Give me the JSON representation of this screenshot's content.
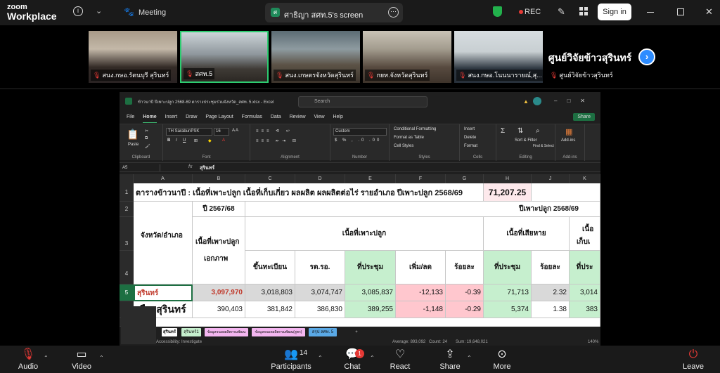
{
  "app": {
    "logo_line1": "zoom",
    "logo_line2": "Workplace"
  },
  "topbar": {
    "meeting_label": "Meeting",
    "share_badge": "ศ",
    "share_title": "ศาธิญา สศท.5's screen",
    "rec_label": "REC",
    "signin_label": "Sign in"
  },
  "participants": [
    {
      "name": "สนง.กษอ.รัตนบุรี สุรินทร์"
    },
    {
      "name": "สศท.5"
    },
    {
      "name": "สนง.เกษตรจังหวัดสุรินทร์"
    },
    {
      "name": "กยท.จังหวัดสุรินทร์"
    },
    {
      "name": "สนง.กษอ.โนนนารายณ์,สุ..."
    },
    {
      "name": "ศูนย์วิจัยข้าวสุรินทร์"
    }
  ],
  "featured_name": "ศูนย์วิจัยข้าวสุรินทร์",
  "excel": {
    "filename": "ข้าวนาปี ปีเพาะปลูก 2568-69 ตารางประชุมร่วมจังหวัด_สศท. 5.xlsx - Excel",
    "search_placeholder": "Search",
    "share_btn": "Share",
    "menu": [
      "File",
      "Home",
      "Insert",
      "Draw",
      "Page Layout",
      "Formulas",
      "Data",
      "Review",
      "View",
      "Help"
    ],
    "ribbon": {
      "clipboard": "Clipboard",
      "paste": "Paste",
      "font_group": "Font",
      "font_name": "TH SarabunPSK",
      "font_size": "16",
      "alignment": "Alignment",
      "number_group": "Number",
      "number_format": "Custom",
      "styles": "Styles",
      "cond_format": "Conditional Formatting",
      "format_table": "Format as Table",
      "cell_styles": "Cell Styles",
      "cells": "Cells",
      "insert": "Insert",
      "delete": "Delete",
      "format": "Format",
      "editing": "Editing",
      "sort_filter": "Sort & Filter",
      "find_select": "Find & Select",
      "addins_group": "Add-ins",
      "addins": "Add-ins"
    },
    "name_box": "A5",
    "formula": "สุรินทร์",
    "col_headers": [
      "A",
      "B",
      "C",
      "D",
      "E",
      "F",
      "G",
      "H",
      "J",
      "K",
      "L"
    ],
    "row_numbers": [
      "1",
      "2",
      "3",
      "4",
      "5",
      "6",
      "7"
    ],
    "title_row": "ตารางข้าวนาปี :  เนื้อที่เพาะปลูก เนื้อที่เก็บเกี่ยว ผลผลิต ผลผลิตต่อไร่ รายอำเภอ ปีเพาะปลูก 2568/69",
    "title_value": "71,207.25",
    "hdr_year_prev": "ปี 2567/68",
    "hdr_year_cur": "ปีเพาะปลูก 2568/69",
    "hdr_province": "จังหวัด/อำเภอ",
    "hdr_planted_line1": "เนื้อที่เพาะปลูก",
    "hdr_planted_line2": "เอกภาพ",
    "hdr_planted_area": "เนื้อที่เพาะปลูก",
    "hdr_damaged": "เนื้อที่เสียหาย",
    "hdr_harvest_cut": "เนื้อ",
    "hdr_harvest_cut2": "เก็บเ",
    "sub_registered": "ขึ้นทะเบียน",
    "sub_rtro": "รต.รอ.",
    "sub_meeting": "ที่ประชุม",
    "sub_change": "เพิ่ม/ลด",
    "sub_percent": "ร้อยละ",
    "sub_meeting2": "ที่ประชุม",
    "sub_percent2": "ร้อยละ",
    "sub_meeting3": "ที่ประ",
    "row5": {
      "name": "สุรินทร์",
      "b": "3,097,970",
      "c": "3,018,803",
      "d": "3,074,747",
      "f": "3,085,837",
      "g": "-12,133",
      "h": "-0.39",
      "j": "71,713",
      "k": "2.32",
      "l": "3,014"
    },
    "row6": {
      "name": "เมืองสุรินทร์",
      "b": "390,403",
      "c": "381,842",
      "d": "386,830",
      "f": "389,255",
      "g": "-1,148",
      "h": "-0.29",
      "j": "5,374",
      "k": "1.38",
      "l": "383"
    },
    "sheet_tabs": [
      "สุรินทร์",
      "สุรินทร์1",
      "ข้อมูลจนผลผลิตกรมพัฒน",
      "ข้อมูลจนผลผลิตกรมพัฒน(สูตร)",
      "สรุป สศท. 5"
    ],
    "status": {
      "accessibility": "Accessibility: Investigate",
      "average": "Average: 893,092",
      "count": "Count: 24",
      "sum": "Sum: 19,648,021",
      "zoom": "140%"
    }
  },
  "bottombar": {
    "audio": "Audio",
    "video": "Video",
    "participants": "Participants",
    "participants_count": "14",
    "chat": "Chat",
    "chat_badge": "1",
    "react": "React",
    "share": "Share",
    "more": "More",
    "leave": "Leave"
  }
}
